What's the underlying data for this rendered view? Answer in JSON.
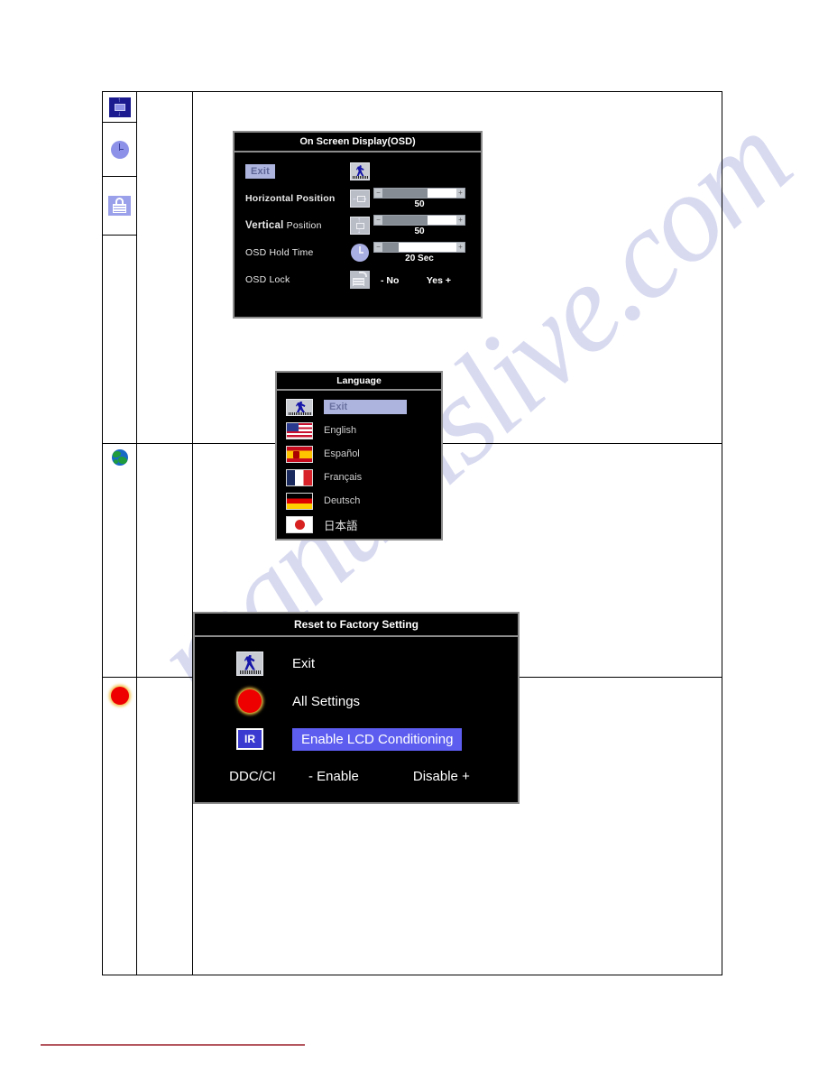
{
  "watermark": {
    "text": "manualslive.com"
  },
  "sidebar_icons": [
    {
      "name": "vertical-position-icon",
      "label": "Vertical Position"
    },
    {
      "name": "osd-hold-time-icon",
      "label": "OSD Hold Time"
    },
    {
      "name": "osd-lock-icon",
      "label": "OSD Lock"
    },
    {
      "name": "language-globe-icon",
      "label": "Language"
    },
    {
      "name": "reset-factory-icon",
      "label": "Reset to Factory Setting"
    }
  ],
  "osd_panel": {
    "title": "On Screen Display(OSD)",
    "rows": [
      {
        "label": "Exit",
        "icon": "exit-person-icon",
        "type": "highlight"
      },
      {
        "label": "Horizontal Position",
        "icon": "horizontal-position-icon",
        "type": "slider",
        "value": "50",
        "fill_pct": 58
      },
      {
        "label_bold": "Vertical",
        "label_rest": "Position",
        "icon": "vertical-position-icon",
        "type": "slider",
        "value": "50",
        "fill_pct": 58
      },
      {
        "label": "OSD Hold Time",
        "icon": "clock-icon",
        "type": "slider",
        "value": "20 Sec",
        "fill_pct": 22
      },
      {
        "label": "OSD Lock",
        "icon": "unlock-icon",
        "type": "yesno",
        "no_label": "- No",
        "yes_label": "Yes +"
      }
    ]
  },
  "language_panel": {
    "title": "Language",
    "items": [
      {
        "name": "Exit",
        "flag": "exit-person-icon",
        "selected": true
      },
      {
        "name": "English",
        "flag": "flag-us"
      },
      {
        "name": "Español",
        "flag": "flag-es"
      },
      {
        "name": "Français",
        "flag": "flag-fr"
      },
      {
        "name": "Deutsch",
        "flag": "flag-de"
      },
      {
        "name": "日本語",
        "flag": "flag-jp"
      }
    ]
  },
  "reset_panel": {
    "title": "Reset to Factory Setting",
    "rows": [
      {
        "label": "Exit",
        "icon": "exit-person-icon"
      },
      {
        "label": "All Settings",
        "icon": "red-circle-icon"
      },
      {
        "label": "Enable LCD Conditioning",
        "icon": "ir-icon",
        "highlight": true
      }
    ],
    "ddc": {
      "label": "DDC/CI",
      "enable_label": "- Enable",
      "disable_label": "Disable +"
    }
  },
  "colors": {
    "highlight_blue": "#adb4de",
    "reset_highlight": "#5d5df0",
    "panel_bg": "#000000",
    "panel_border": "#8c8c8c",
    "watermark": "#b9bde4",
    "bottom_rule": "#b5575f"
  }
}
